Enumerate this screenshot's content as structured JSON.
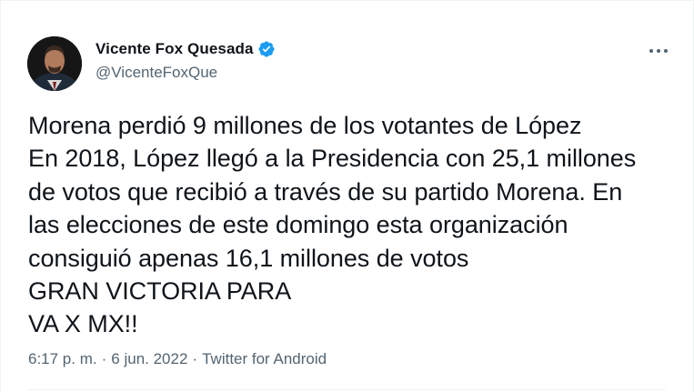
{
  "author": {
    "name": "Vicente Fox Quesada",
    "handle": "@VicenteFoxQue",
    "verified": true
  },
  "icons": {
    "verified": "verified-badge-icon",
    "more": "more-options-icon"
  },
  "colors": {
    "text": "#0f1419",
    "secondary": "#536471",
    "verified": "#1d9bf0",
    "border": "#eff3f4"
  },
  "tweet": {
    "lines": [
      "Morena perdió 9 millones de los votantes de López",
      "En 2018, López llegó a la Presidencia con 25,1 millones",
      "de votos que recibió a través de su partido Morena. En",
      "las elecciones de este domingo esta organización",
      "consiguió apenas 16,1 millones de votos",
      "GRAN VICTORIA PARA",
      "VA X MX!!"
    ]
  },
  "meta": {
    "time": "6:17 p. m.",
    "separator": "·",
    "date": "6 jun. 2022",
    "source": "Twitter for Android"
  }
}
